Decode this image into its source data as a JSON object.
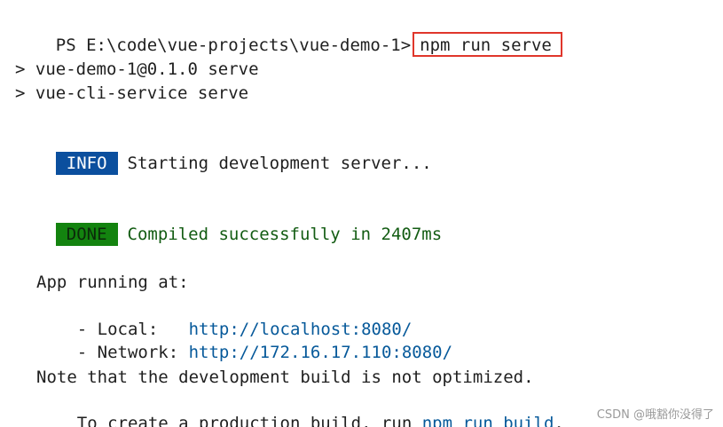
{
  "terminal": {
    "prompt": "PS E:\\code\\vue-projects\\vue-demo-1>",
    "command": "npm run serve",
    "script_line_1": "> vue-demo-1@0.1.0 serve",
    "script_line_2": "> vue-cli-service serve",
    "info_badge": "INFO",
    "info_text": "Starting development server...",
    "done_badge": "DONE",
    "done_text": "Compiled successfully in 2407ms",
    "app_running": "App running at:",
    "local_label": "- Local:   ",
    "local_url": "http://localhost:8080/",
    "network_label": "- Network: ",
    "network_url": "http://172.16.17.110:8080/",
    "note_line_1": "Note that the development build is not optimized.",
    "note_line_2_prefix": "To create a production build, run ",
    "note_line_2_command": "npm run build",
    "note_line_2_suffix": "."
  },
  "watermark": "CSDN @哦豁你没得了",
  "colors": {
    "command_highlight_border": "#e0362b",
    "info_badge_bg": "#0b4f9e",
    "done_badge_bg": "#13830f",
    "done_text": "#135c13",
    "link": "#06599a"
  }
}
